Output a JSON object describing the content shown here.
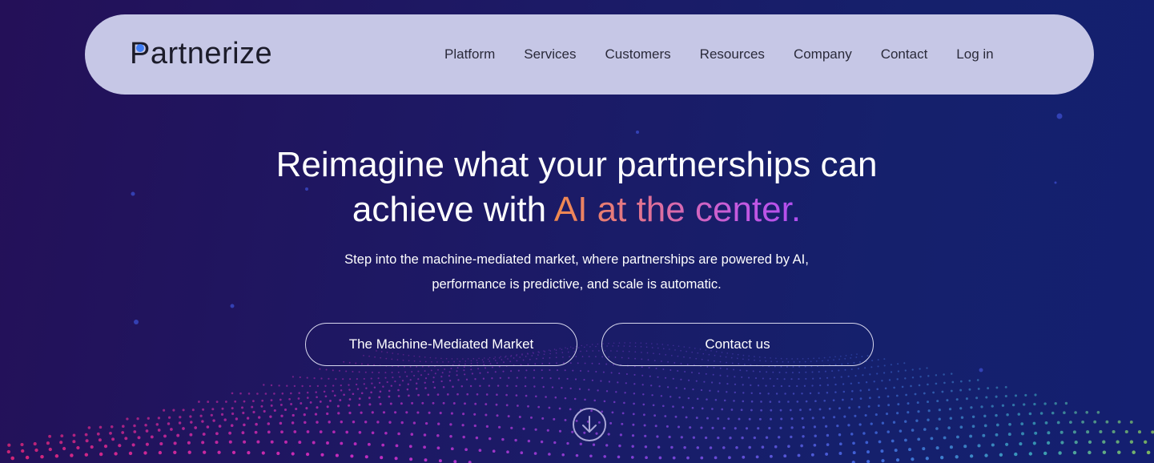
{
  "brand": {
    "logo_text": "Partnerize",
    "accent_color": "#3f7df4"
  },
  "nav": {
    "items": [
      {
        "label": "Platform"
      },
      {
        "label": "Services"
      },
      {
        "label": "Customers"
      },
      {
        "label": "Resources"
      },
      {
        "label": "Company"
      },
      {
        "label": "Contact"
      },
      {
        "label": "Log in"
      }
    ]
  },
  "hero": {
    "title_line1": "Reimagine what your partnerships can",
    "title_line2_prefix": "achieve with ",
    "title_highlight": "AI at the center.",
    "subtitle_line1": "Step into the machine-mediated market, where partnerships are powered by AI,",
    "subtitle_line2": "performance is predictive, and scale is automatic.",
    "primary_cta": "The Machine-Mediated Market",
    "secondary_cta": "Contact us"
  },
  "scroll_icon": "arrow-down-circle-icon",
  "colors": {
    "background_start": "#241058",
    "background_end": "#141f70",
    "nav_background": "#c6c7e6",
    "highlight_gradient": [
      "#f08a4c",
      "#e0709a",
      "#c45ae0",
      "#b14df0"
    ]
  }
}
